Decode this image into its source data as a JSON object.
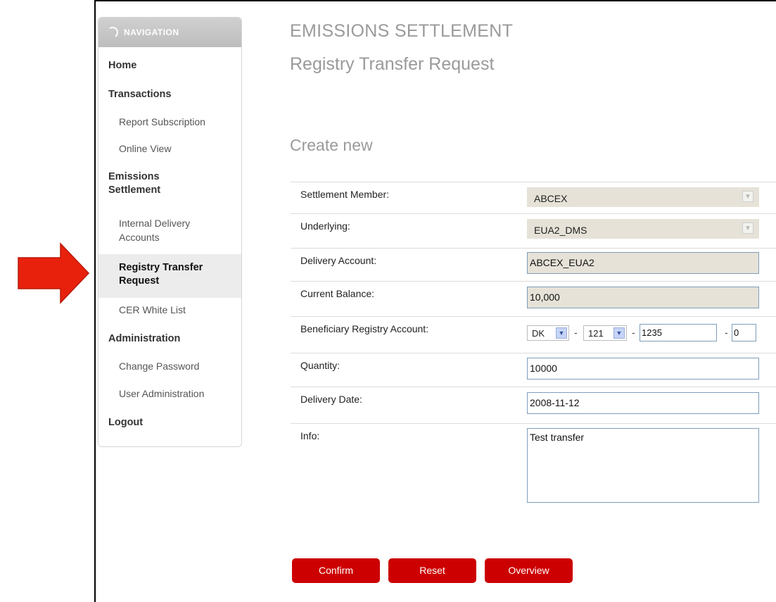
{
  "nav": {
    "header": "NAVIGATION",
    "items": [
      {
        "label": "Home",
        "level": 1
      },
      {
        "label": "Transactions",
        "level": 1
      },
      {
        "label": "Report Subscription",
        "level": 2
      },
      {
        "label": "Online View",
        "level": 2
      },
      {
        "label": "Emissions Settlement",
        "level": 1
      },
      {
        "label": "Internal Delivery Accounts",
        "level": 2
      },
      {
        "label": "Registry Transfer Request",
        "level": 2,
        "active": true
      },
      {
        "label": "CER White List",
        "level": 2
      },
      {
        "label": "Administration",
        "level": 1
      },
      {
        "label": "Change Password",
        "level": 2
      },
      {
        "label": "User Administration",
        "level": 2
      },
      {
        "label": "Logout",
        "level": 1
      }
    ]
  },
  "page": {
    "title": "EMISSIONS SETTLEMENT",
    "subtitle": "Registry Transfer Request",
    "section": "Create new"
  },
  "form": {
    "settlement_member": {
      "label": "Settlement Member:",
      "value": "ABCEX"
    },
    "underlying": {
      "label": "Underlying:",
      "value": "EUA2_DMS"
    },
    "delivery_account": {
      "label": "Delivery Account:",
      "value": "ABCEX_EUA2"
    },
    "current_balance": {
      "label": "Current Balance:",
      "value": "10,000"
    },
    "beneficiary": {
      "label": "Beneficiary Registry Account:",
      "country": "DK",
      "code": "121",
      "account": "1235",
      "check": "0",
      "sep": "-"
    },
    "quantity": {
      "label": "Quantity:",
      "value": "10000"
    },
    "delivery_date": {
      "label": "Delivery Date:",
      "value": "2008-11-12"
    },
    "info": {
      "label": "Info:",
      "value": "Test transfer"
    }
  },
  "buttons": {
    "confirm": "Confirm",
    "reset": "Reset",
    "overview": "Overview"
  },
  "colors": {
    "accent": "#cc0000",
    "arrow": "#e8210d"
  }
}
